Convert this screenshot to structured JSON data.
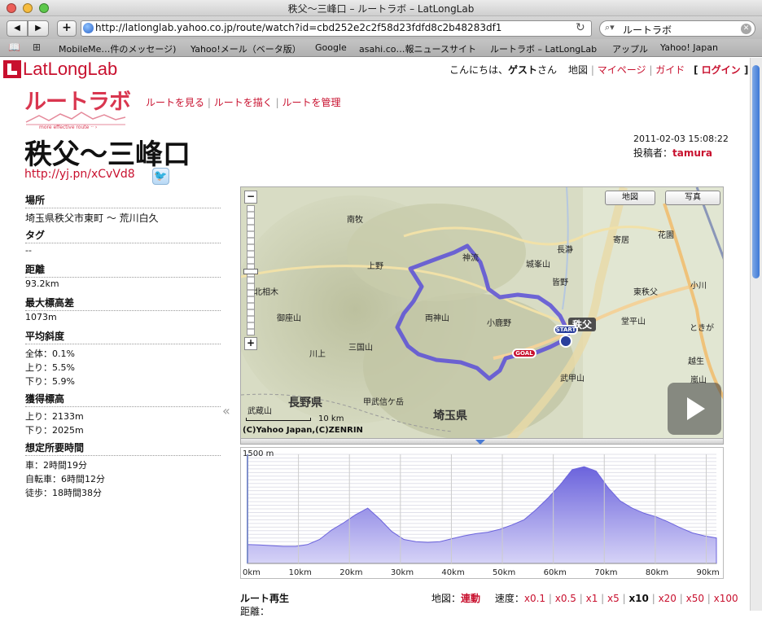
{
  "browser": {
    "window_title": "秩父〜三峰口 – ルートラボ – LatLongLab",
    "url": "http://latlonglab.yahoo.co.jp/route/watch?id=cbd252e2c2f58d23fdfd8c2b48283df1",
    "search_value": "ルートラボ",
    "bookmarks": [
      "MobileMe…件のメッセージ)",
      "Yahoo!メール（ベータ版）",
      "Google",
      "asahi.co…報ニュースサイト",
      "ルートラボ – LatLongLab",
      "アップル",
      "Yahoo! Japan"
    ]
  },
  "header": {
    "logo_text": "LatLongLab",
    "greeting_prefix": "こんにちは、",
    "user": "ゲスト",
    "greeting_suffix": "さん",
    "map_link": "地図",
    "mypage": "マイページ",
    "guide": "ガイド",
    "login": "ログイン",
    "routelab_logo": "ルートラボ",
    "routelab_tagline": "more effective route ·· ›",
    "nav": [
      "ルートを見る",
      "ルートを描く",
      "ルートを管理"
    ]
  },
  "route": {
    "title": "秩父〜三峰口",
    "short_url": "http://yj.pn/xCvVd8",
    "date": "2011-02-03 15:08:22",
    "poster_label": "投稿者：",
    "poster": "tamura"
  },
  "sidebar": {
    "location_h": "場所",
    "location": "埼玉県秩父市東町 〜 荒川白久",
    "tag_h": "タグ",
    "tag": "--",
    "distance_h": "距離",
    "distance": "93.2km",
    "elev_h": "最大標高差",
    "elev": "1073m",
    "slope_h": "平均斜度",
    "slope_all": "全体：0.1%",
    "slope_up": "上り：5.5%",
    "slope_down": "下り：5.9%",
    "gain_h": "獲得標高",
    "gain_up": "上り：2133m",
    "gain_down": "下り：2025m",
    "time_h": "想定所要時間",
    "time_car": "車：2時間19分",
    "time_bike": "自転車：6時間12分",
    "time_walk": "徒歩：18時間38分",
    "collapse": "«"
  },
  "map": {
    "btn_map": "地図",
    "btn_photo": "写真",
    "scale": "10 km",
    "copyright": "(C)Yahoo Japan,(C)ZENRIN",
    "labels": [
      "南牧",
      "上野",
      "神流",
      "城峯山",
      "皆野",
      "長瀞",
      "寄居",
      "北相木",
      "御座山",
      "両神山",
      "小鹿野",
      "秩父",
      "東秩父",
      "小川",
      "堂平山",
      "ときが",
      "三国山",
      "川上",
      "長野県",
      "埼玉県",
      "甲武信ケ岳",
      "武甲山",
      "越生",
      "嵐山",
      "花園",
      "武蔵山"
    ],
    "start": "START",
    "goal": "GOAL",
    "zoom_in": "+",
    "zoom_out": "−"
  },
  "profile": {
    "ymax_label": "1500 m",
    "x_ticks": [
      "0km",
      "10km",
      "20km",
      "30km",
      "40km",
      "50km",
      "60km",
      "70km",
      "80km",
      "90km"
    ],
    "elevations_m": [
      260,
      255,
      245,
      235,
      235,
      260,
      330,
      460,
      560,
      670,
      760,
      610,
      440,
      330,
      300,
      290,
      300,
      340,
      380,
      410,
      430,
      470,
      530,
      600,
      740,
      900,
      1080,
      1290,
      1330,
      1270,
      1040,
      860,
      760,
      690,
      640,
      570,
      490,
      420,
      380,
      350
    ]
  },
  "playback": {
    "title": "ルート再生",
    "map_label": "地図：",
    "map_mode": "連動",
    "speed_label": "速度：",
    "speeds": [
      "x0.1",
      "x0.5",
      "x1",
      "x5",
      "x10",
      "x20",
      "x50",
      "x100"
    ],
    "distance_label": "距離："
  },
  "colors": {
    "accent": "#c8102e",
    "route": "#5a4fd8",
    "profile_fill": "#7b74e0"
  }
}
